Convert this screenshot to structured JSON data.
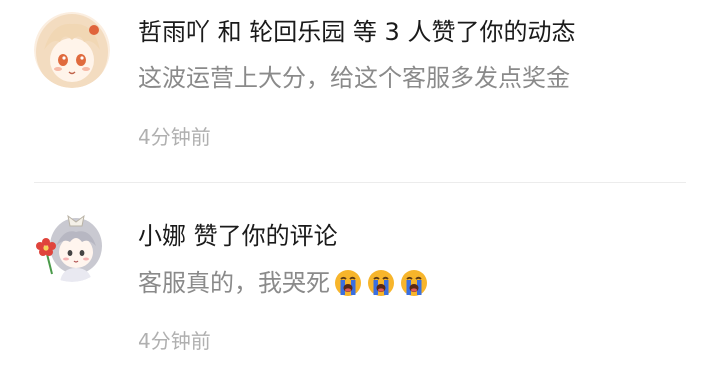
{
  "notifications": [
    {
      "actor_1": "哲雨吖",
      "conj": "和",
      "actor_2": "轮回乐园",
      "count_text": "等 3 人",
      "action": "赞了你的动态",
      "content_text": "这波运营上大分，给这个客服多发点奖金",
      "time": "4分钟前",
      "avatar_icon": "anime-girl-avatar"
    },
    {
      "actor_1": "小娜",
      "action": "赞了你的评论",
      "content_text": "客服真的，我哭死",
      "content_emojis": [
        "loudly-crying-face-icon",
        "loudly-crying-face-icon",
        "loudly-crying-face-icon"
      ],
      "time": "4分钟前",
      "avatar_icon": "chibi-girl-flower-avatar"
    }
  ],
  "colors": {
    "primary_text": "#1a1a1a",
    "secondary_text": "#8a8a8a",
    "time_text": "#b0b0b0",
    "divider": "#ececec",
    "emoji_face": "#f7b52b",
    "emoji_tears": "#3a6fe0"
  }
}
